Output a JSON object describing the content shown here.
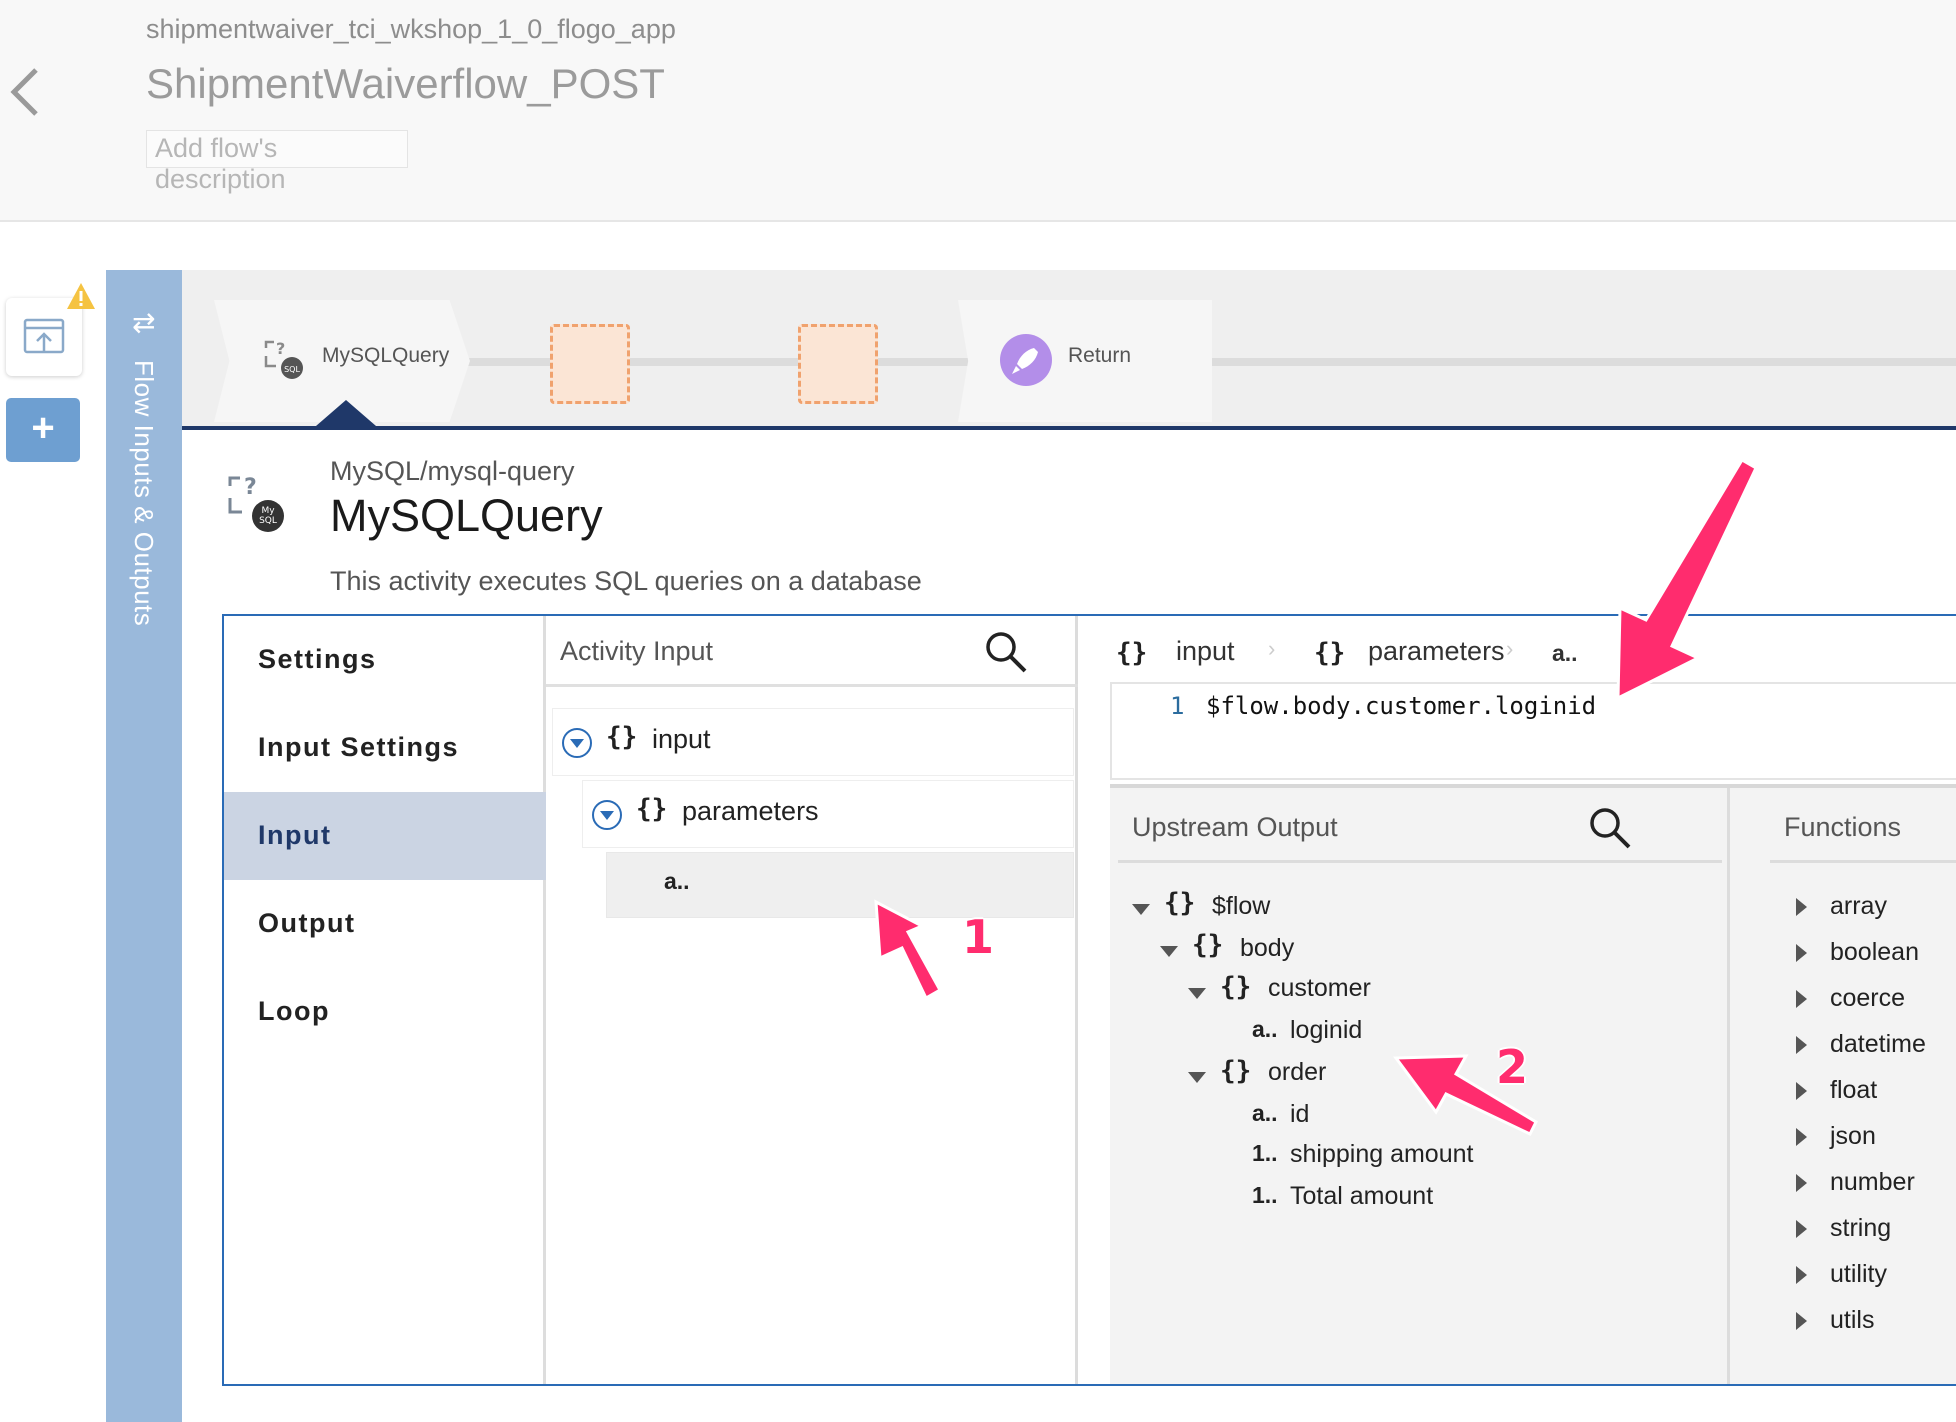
{
  "header": {
    "app_name": "shipmentwaiver_tci_wkshop_1_0_flogo_app",
    "flow_name": "ShipmentWaiverflow_POST",
    "description_placeholder": "Add flow's description"
  },
  "side_bar": {
    "label": "Flow Inputs & Outputs"
  },
  "flow_strip": {
    "tiles": [
      {
        "label": "MySQLQuery",
        "icon": "mysql-icon"
      },
      {
        "label": "Return",
        "icon": "rocket-icon"
      }
    ]
  },
  "activity": {
    "ref": "MySQL/mysql-query",
    "title": "MySQLQuery",
    "description": "This activity executes SQL queries on a database"
  },
  "nav": {
    "items": [
      "Settings",
      "Input Settings",
      "Input",
      "Output",
      "Loop"
    ],
    "active": "Input"
  },
  "activity_input": {
    "title": "Activity Input",
    "tree": {
      "root": "input",
      "child": "parameters",
      "leaf_prefix": "a.."
    }
  },
  "mapper": {
    "breadcrumb": [
      "input",
      "parameters",
      "a.."
    ],
    "line_number": "1",
    "expression": "$flow.body.customer.loginid"
  },
  "upstream": {
    "title": "Upstream Output",
    "nodes": [
      {
        "prefix": "{}",
        "label": "$flow"
      },
      {
        "prefix": "{}",
        "label": "body"
      },
      {
        "prefix": "{}",
        "label": "customer"
      },
      {
        "prefix": "a..",
        "label": "loginid"
      },
      {
        "prefix": "{}",
        "label": "order"
      },
      {
        "prefix": "a..",
        "label": "id"
      },
      {
        "prefix": "1..",
        "label": "shipping amount"
      },
      {
        "prefix": "1..",
        "label": "Total amount"
      }
    ]
  },
  "functions": {
    "title": "Functions",
    "items": [
      "array",
      "boolean",
      "coerce",
      "datetime",
      "float",
      "json",
      "number",
      "string",
      "utility",
      "utils"
    ]
  },
  "annotations": {
    "marker_1": "1",
    "marker_2": "2",
    "color": "#ff2c6e"
  },
  "colors": {
    "accent": "#2a6bb6",
    "nav_active": "#cbd4e3",
    "io_bar": "#9ab9db",
    "navy": "#1f3869"
  }
}
